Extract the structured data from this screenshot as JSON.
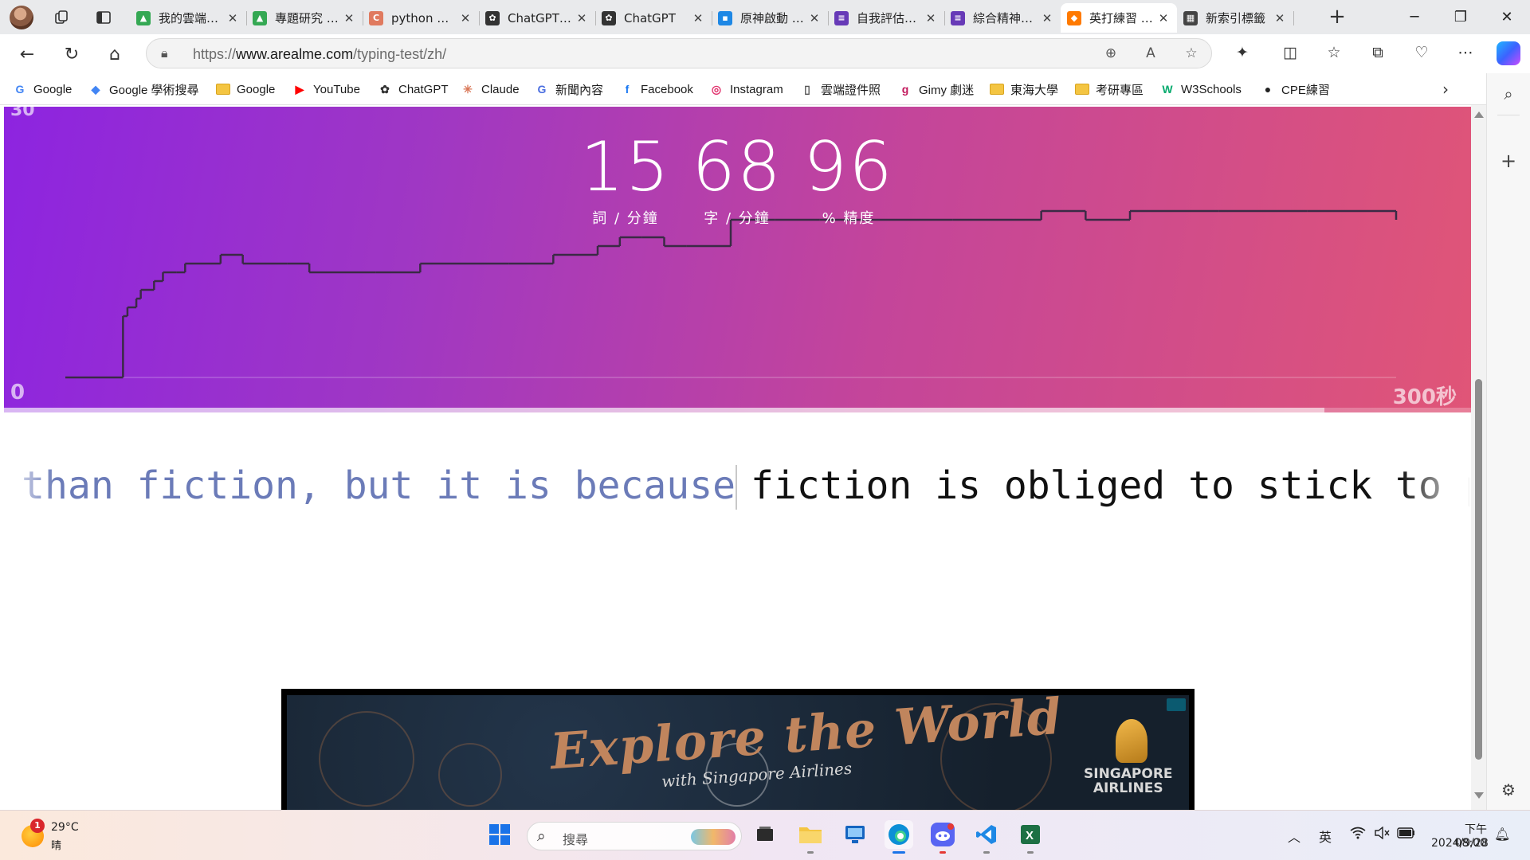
{
  "browser": {
    "tabs": [
      {
        "title": "我的雲端硬碟",
        "icon": "google-drive-icon",
        "color": "#34a853",
        "active": false
      },
      {
        "title": "專題研究 - Google 雲端硬碟",
        "icon": "google-drive-icon",
        "color": "#34a853",
        "active": false
      },
      {
        "title": "python 文件",
        "icon": "c-letter-icon",
        "color": "#e07a5f",
        "active": false
      },
      {
        "title": "ChatGPT | OpenAI",
        "icon": "openai-icon",
        "color": "#333333",
        "active": false
      },
      {
        "title": "ChatGPT",
        "icon": "openai-icon",
        "color": "#333333",
        "active": false
      },
      {
        "title": "原神啟動 - 動畫瘋",
        "icon": "bahamut-icon",
        "color": "#1e88e5",
        "active": false
      },
      {
        "title": "自我評估報告",
        "icon": "forms-icon",
        "color": "#673ab7",
        "active": false
      },
      {
        "title": "綜合精神性評估",
        "icon": "forms-icon",
        "color": "#673ab7",
        "active": false
      },
      {
        "title": "英打練習 / 打字測驗",
        "icon": "fox-icon",
        "color": "#ff7a00",
        "active": true
      },
      {
        "title": "新索引標籤",
        "icon": "newtab-icon",
        "color": "#444444",
        "active": false
      }
    ],
    "address": {
      "scheme": "https://",
      "host": "www.arealme.com",
      "path": "/typing-test/zh/"
    },
    "bookmarks": [
      {
        "label": "Google",
        "icon": "google-icon",
        "color": "#4285f4"
      },
      {
        "label": "Google 學術搜尋",
        "icon": "scholar-icon",
        "color": "#4285f4"
      },
      {
        "label": "Google",
        "icon": "folder-icon",
        "color": "#f4c542"
      },
      {
        "label": "YouTube",
        "icon": "youtube-icon",
        "color": "#ff0000"
      },
      {
        "label": "ChatGPT",
        "icon": "openai-icon",
        "color": "#333333"
      },
      {
        "label": "Claude",
        "icon": "claude-icon",
        "color": "#d97757"
      },
      {
        "label": "新聞內容",
        "icon": "news-icon",
        "color": "#4a6ee0"
      },
      {
        "label": "Facebook",
        "icon": "facebook-icon",
        "color": "#1877f2"
      },
      {
        "label": "Instagram",
        "icon": "instagram-icon",
        "color": "#e1306c"
      },
      {
        "label": "雲端證件照",
        "icon": "page-icon",
        "color": "#555555"
      },
      {
        "label": "Gimy 劇迷",
        "icon": "gimy-icon",
        "color": "#c2185b"
      },
      {
        "label": "東海大學",
        "icon": "folder-icon",
        "color": "#f4c542"
      },
      {
        "label": "考研專區",
        "icon": "folder-icon",
        "color": "#f4c542"
      },
      {
        "label": "W3Schools",
        "icon": "w3schools-icon",
        "color": "#04aa6d"
      },
      {
        "label": "CPE練習",
        "icon": "github-icon",
        "color": "#222222"
      }
    ]
  },
  "page": {
    "hero_top_num": "30",
    "stats": [
      {
        "value": "15",
        "label": "詞 / 分鐘"
      },
      {
        "value": "68",
        "label": "字 / 分鐘"
      },
      {
        "value": "96",
        "label": "% 精度"
      }
    ],
    "axis_start": "0",
    "axis_end": "300秒",
    "progress_fraction": 0.9,
    "typing": {
      "typed": "Truth is stranger than fiction, but it is because",
      "pending": "fiction is obliged to stick to possibilities"
    },
    "ad": {
      "headline": "Explore the World",
      "subline": "with Singapore Airlines",
      "brand_line1": "SINGAPORE",
      "brand_line2": "AIRLINES"
    }
  },
  "chart_data": {
    "type": "line",
    "x": [
      0,
      13,
      14,
      16,
      17,
      20,
      22,
      25,
      27,
      30,
      35,
      40,
      45,
      50,
      55,
      60,
      70,
      80,
      90,
      100,
      110,
      120,
      125,
      130,
      135,
      140,
      150,
      160,
      170,
      180,
      200,
      220,
      230,
      240,
      260,
      280,
      300
    ],
    "values": [
      0,
      7,
      8,
      9,
      10,
      11,
      12,
      12,
      13,
      13,
      14,
      13,
      13,
      13,
      12,
      12,
      12,
      13,
      13,
      13,
      14,
      15,
      16,
      16,
      15,
      15,
      18,
      18,
      18,
      18,
      18,
      19,
      18,
      19,
      19,
      19,
      18
    ],
    "xlim": [
      0,
      300
    ],
    "ylim": [
      0,
      30
    ],
    "x_tick_labels": [
      "0",
      "300秒"
    ],
    "y_tick_labels": [
      "30"
    ],
    "grid": false
  },
  "taskbar": {
    "weather_temp": "29°C",
    "weather_cond": "晴",
    "weather_badge": "1",
    "search_placeholder": "搜尋",
    "ime": "英",
    "time": "下午 08:00",
    "date": "2024/9/28"
  }
}
